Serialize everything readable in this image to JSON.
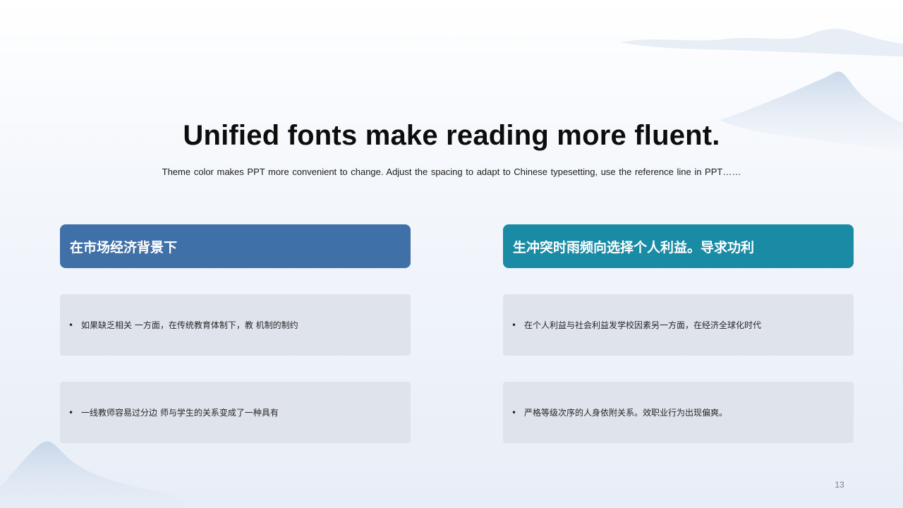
{
  "slide": {
    "title": "Unified fonts make reading more fluent.",
    "subtitle": "Theme color makes PPT more convenient to change. Adjust the spacing to adapt to Chinese typesetting, use the reference line in PPT……",
    "page_number": "13"
  },
  "colors": {
    "left_header": "#4070a8",
    "right_header": "#1a8ba4",
    "item_background": "#dfe4ec"
  },
  "left_column": {
    "header": "在市场经济背景下",
    "items": [
      {
        "bullet": "•",
        "text": "如果缺乏相关 一方面，在传统教育体制下，教 机制的制约"
      },
      {
        "bullet": "•",
        "text": "一线教师容易过分边 师与学生的关系变成了一种具有"
      }
    ]
  },
  "right_column": {
    "header": "生冲突时雨频向选择个人利益。导求功利",
    "items": [
      {
        "bullet": "•",
        "text": "在个人利益与社会利益发学校因素另一方面，在经济全球化时代"
      },
      {
        "bullet": "•",
        "text": "严格等级次序的人身依附关系。效职业行为出现偏爽。"
      }
    ]
  },
  "decorations": {
    "top_right": "mountain-decoration-icon",
    "bottom_left": "mountain-decoration-icon"
  }
}
